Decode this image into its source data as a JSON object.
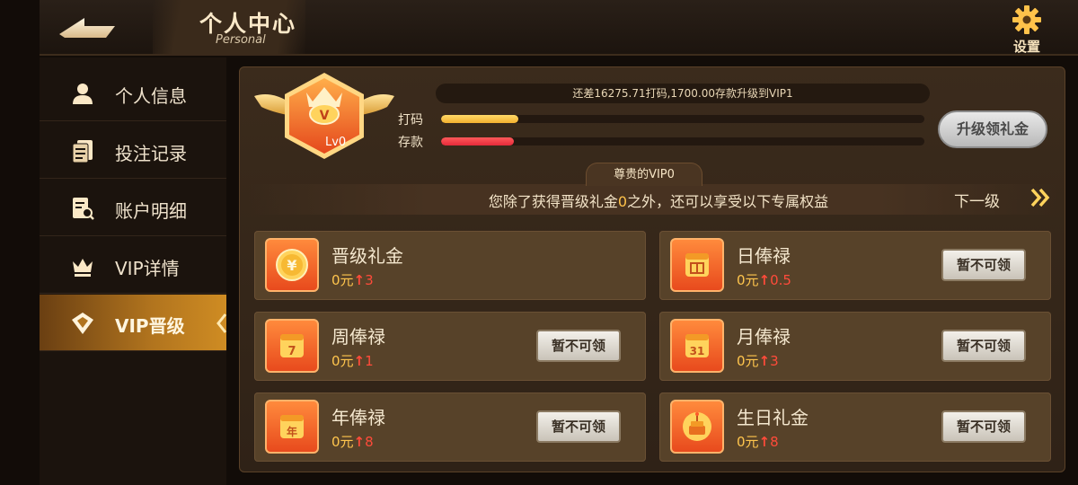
{
  "header": {
    "title": "个人中心",
    "subtitle": "Personal",
    "settings_label": "设置"
  },
  "sidebar": {
    "items": [
      {
        "label": "个人信息",
        "icon": "user-icon"
      },
      {
        "label": "投注记录",
        "icon": "document-list-icon"
      },
      {
        "label": "账户明细",
        "icon": "document-search-icon"
      },
      {
        "label": "VIP详情",
        "icon": "crown-icon"
      },
      {
        "label": "VIP晋级",
        "icon": "diamond-badge-icon",
        "active": true
      }
    ]
  },
  "vip": {
    "level_badge": "Lv0",
    "progress_text": "还差16275.71打码,1700.00存款升级到VIP1",
    "bet_label": "打码",
    "bet_progress": 0.16,
    "deposit_label": "存款",
    "deposit_progress": 0.15,
    "upgrade_button": "升级领礼金",
    "tab_label": "尊贵的VIP0",
    "benefit_text_pre": "您除了获得晋级礼金",
    "benefit_highlight": "0",
    "benefit_text_post": "之外，还可以享受以下专属权益",
    "next_level_label": "下一级"
  },
  "cards": [
    {
      "name": "晋级礼金",
      "base": "0元",
      "increase": "3",
      "icon": "yuan-coin-icon",
      "button": ""
    },
    {
      "name": "日俸禄",
      "base": "0元",
      "increase": "0.5",
      "icon": "calendar-day-icon",
      "button": "暂不可领"
    },
    {
      "name": "周俸禄",
      "base": "0元",
      "increase": "1",
      "icon": "calendar-7-icon",
      "button": "暂不可领"
    },
    {
      "name": "月俸禄",
      "base": "0元",
      "increase": "3",
      "icon": "calendar-31-icon",
      "button": "暂不可领"
    },
    {
      "name": "年俸禄",
      "base": "0元",
      "increase": "8",
      "icon": "calendar-year-icon",
      "button": "暂不可领"
    },
    {
      "name": "生日礼金",
      "base": "0元",
      "increase": "8",
      "icon": "birthday-cake-icon",
      "button": "暂不可领"
    }
  ],
  "icon_glyphs": {
    "calendar_7": "7",
    "calendar_31": "31",
    "calendar_year": "年"
  },
  "colors": {
    "accent_gold": "#ffc24a",
    "increase_red": "#ff4b3a",
    "active_tab": "#b1741e"
  }
}
